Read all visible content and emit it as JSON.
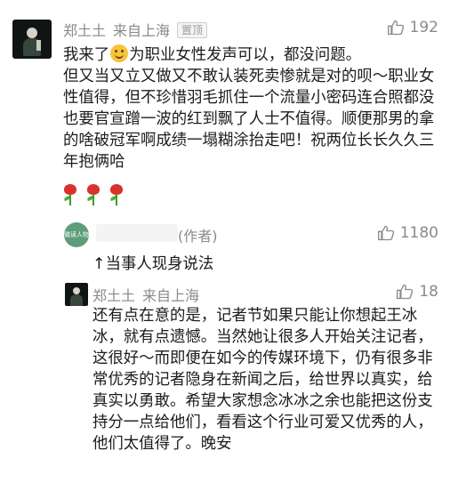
{
  "top_comment": {
    "author": "郑土土",
    "location": "来自上海",
    "pinned_badge": "置顶",
    "likes": "192",
    "text_before_emoji": "我来了",
    "emoji": "smiley-face-icon",
    "text_after_emoji": "为职业女性发声可以，都没问题。\n但又当又立又做又不敢认装死卖惨就是对的呗～职业女性值得，但不珍惜羽毛抓住一个流量小密码连合照都没也要官宣蹭一波的红到飘了人士不值得。顺便那男的拿的啥破冠军啊成绩一塌糊涂抬走吧！祝两位长长久久三年抱俩哈",
    "roses": [
      "rose-icon",
      "rose-icon",
      "rose-icon"
    ]
  },
  "author_reply": {
    "avatar_text": "微读人物",
    "author_tag": "(作者)",
    "likes": "1180",
    "text": "↑当事人现身说法"
  },
  "second_reply": {
    "author": "郑土土",
    "location": "来自上海",
    "likes": "18",
    "text": "还有点在意的是，记者节如果只能让你想起王冰冰，就有点遗憾。当然她让很多人开始关注记者，这很好～而即便在如今的传媒环境下，仍有很多非常优秀的记者隐身在新闻之后，给世界以真实，给真实以勇敢。希望大家想念冰冰之余也能把这份支持分一点给他们，看看这个行业可爱又优秀的人，他们太值得了。晚安"
  },
  "colors": {
    "meta_gray": "#8a8a8a",
    "text_dark": "#1b1b1b",
    "rose_red": "#d9322d",
    "badge_border": "#cfcfcf"
  }
}
